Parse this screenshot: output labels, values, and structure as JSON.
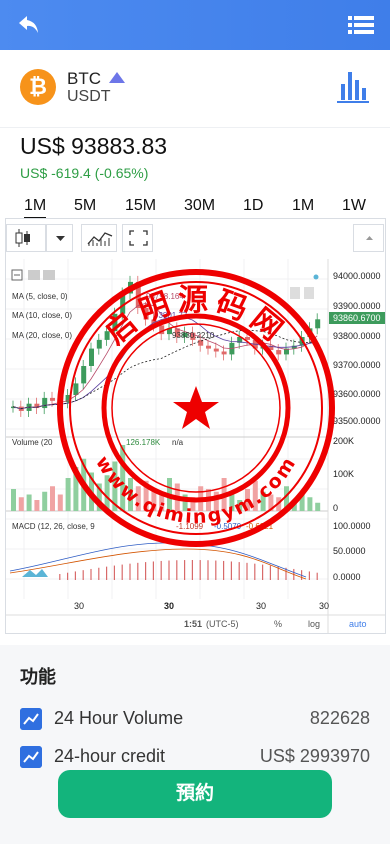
{
  "header": {
    "back_icon": "back-arrow-icon",
    "menu_icon": "list-menu-icon"
  },
  "pair": {
    "coin_symbol": "₿",
    "base": "BTC",
    "quote": "USDT",
    "coin_color": "#f7931a"
  },
  "ticker": {
    "price": "US$ 93883.83",
    "change": "US$ -619.4 (-0.65%)"
  },
  "intervals": [
    "1M",
    "5M",
    "15M",
    "30M",
    "1D",
    "1M",
    "1W"
  ],
  "chart": {
    "indicators": [
      "MA (5, close, 0)",
      "MA (10, close, 0)",
      "MA (20, close, 0)"
    ],
    "price_axis": [
      "94000.0000",
      "93900.0000",
      "93800.0000",
      "93700.0000",
      "93600.0000",
      "93500.0000"
    ],
    "current_price": "93860.6700",
    "ma_values": [
      "93798.164",
      "93801.77",
      "93830.2210"
    ],
    "volume_label": "Volume (20",
    "volume_value": "126.178K",
    "volume_na": "n/a",
    "volume_axis": [
      "200K",
      "100K",
      "0"
    ],
    "macd_label": "MACD (12, 26, close, 9",
    "macd_values": [
      "-1.1099",
      "-0.5070",
      "-0.6021"
    ],
    "macd_axis": [
      "100.0000",
      "50.0000",
      "0.0000"
    ],
    "x_ticks": [
      "30",
      "30",
      "30",
      "30",
      "30"
    ],
    "time_label": "1:51",
    "timezone": "(UTC-5)",
    "percent_label": "%",
    "log_label": "log",
    "auto_label": "auto"
  },
  "stamp": {
    "name": "启明源码网",
    "url": "www.qimingym.com"
  },
  "features": {
    "title": "功能",
    "rows": [
      {
        "label": "24 Hour Volume",
        "value": "822628"
      },
      {
        "label": "24-hour credit",
        "value": "US$ 2993970"
      }
    ]
  },
  "order_button": "預約"
}
